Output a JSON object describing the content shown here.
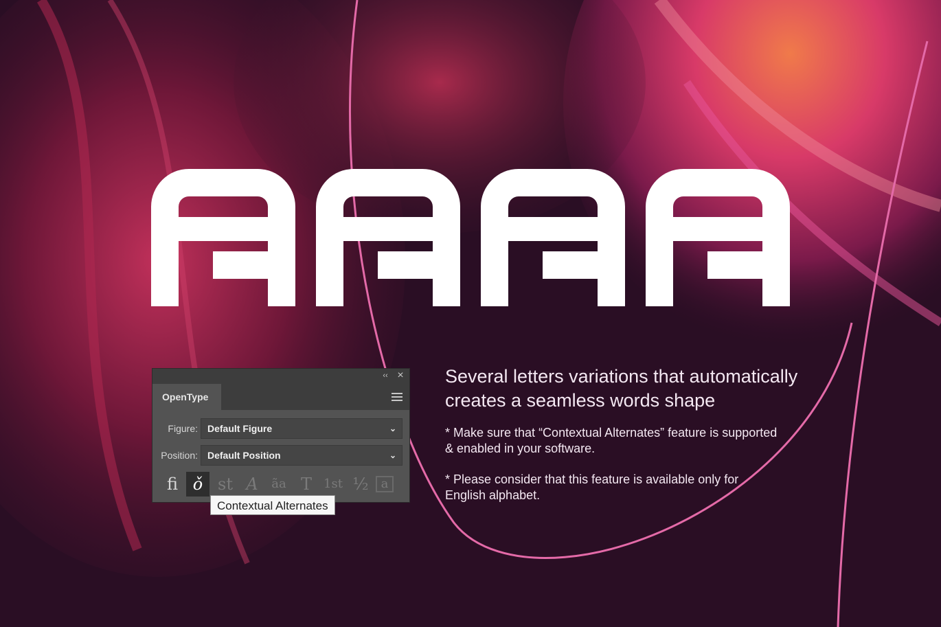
{
  "headline": {
    "glyphs": [
      "A",
      "A",
      "A",
      "A"
    ]
  },
  "description": {
    "title_line1": "Several letters variations that automatically",
    "title_line2": "creates a seamless words shape",
    "note1_line1": "* Make sure that “Contextual Alternates” feature is supported",
    "note1_line2": "& enabled in your software.",
    "note2_line1": "* Please  consider that this feature is available only for",
    "note2_line2": "English alphabet."
  },
  "panel": {
    "collapse_icon": "‹‹",
    "close_icon": "×",
    "tab_label": "OpenType",
    "figure_label": "Figure:",
    "figure_value": "Default Figure",
    "position_label": "Position:",
    "position_value": "Default Position",
    "glyph_buttons": [
      "fi",
      "ǒ",
      "st",
      "A",
      "ãa",
      "T",
      "1st",
      "½",
      "a"
    ],
    "tooltip": "Contextual Alternates"
  },
  "colors": {
    "background": "#2a0e24",
    "panel": "#535353",
    "panel_dark": "#3d3d3d",
    "accent_pink": "#e46aa8",
    "text": "#f4e8f2"
  }
}
